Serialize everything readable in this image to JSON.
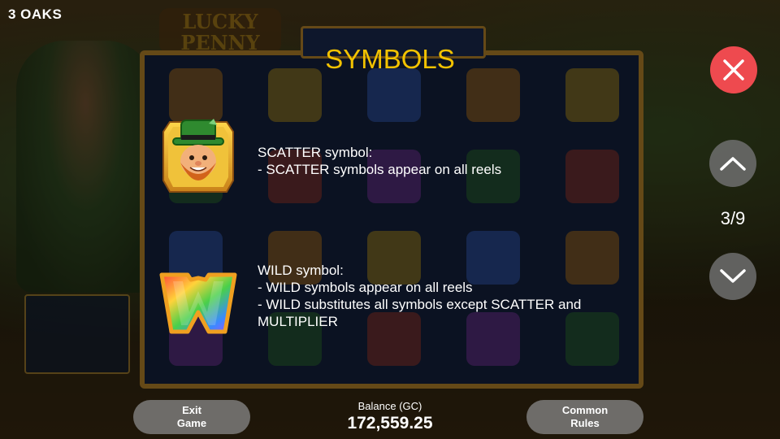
{
  "brand": "3 OAKS",
  "background_logo": "LUCKY PENNY",
  "dialog": {
    "title": "SYMBOLS",
    "page_indicator": "3/9"
  },
  "symbols": [
    {
      "name_line": "SCATTER symbol:",
      "lines": [
        "- SCATTER symbols appear on all reels"
      ],
      "icon": "leprechaun-scatter-icon"
    },
    {
      "name_line": "WILD symbol:",
      "lines": [
        "- WILD symbols appear on all reels",
        "- WILD substitutes all symbols except SCATTER and MULTIPLIER"
      ],
      "icon": "wild-w-icon"
    }
  ],
  "footer": {
    "exit_line1": "Exit",
    "exit_line2": "Game",
    "balance_label": "Balance (GC)",
    "balance_value": "172,559.25",
    "rules_line1": "Common",
    "rules_line2": "Rules"
  },
  "colors": {
    "title": "#f2c200",
    "close_button": "#ee4a4f",
    "nav_button": "#6e6e6e",
    "pill_button": "#828282"
  }
}
